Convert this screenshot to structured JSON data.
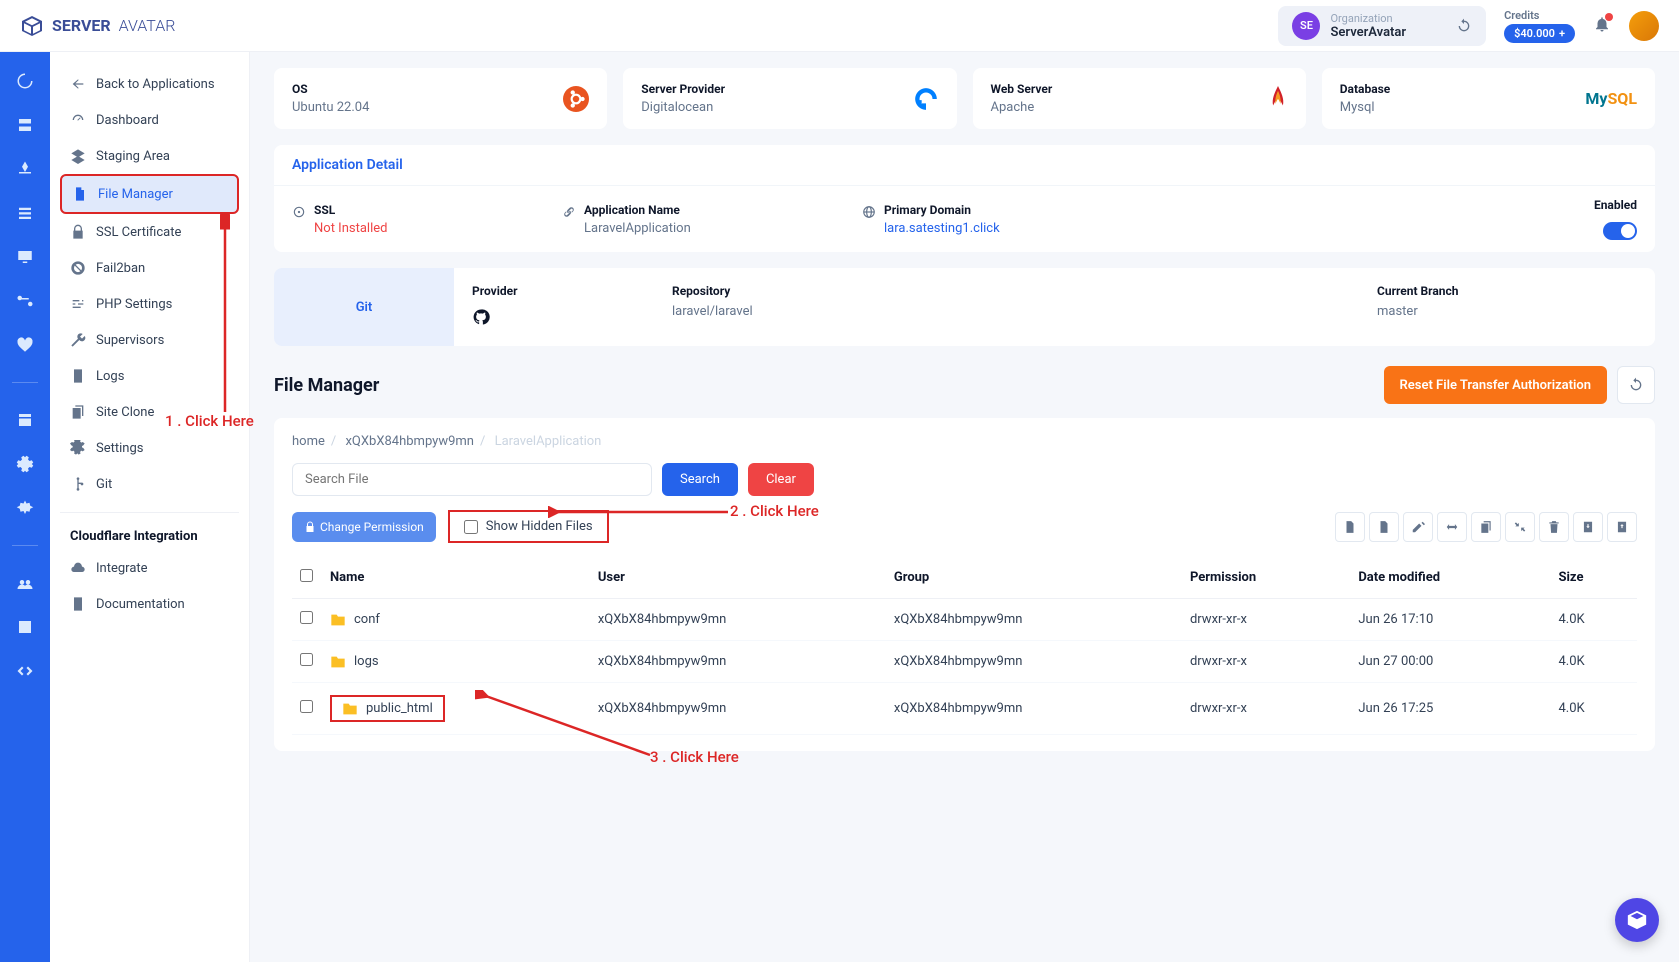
{
  "brand": {
    "name1": "SERVER",
    "name2": "AVATAR"
  },
  "org": {
    "badge": "SE",
    "label": "Organization",
    "name": "ServerAvatar"
  },
  "credits": {
    "label": "Credits",
    "value": "$40.000",
    "plus": "+"
  },
  "sidebar": {
    "back": "Back to Applications",
    "items": [
      {
        "label": "Dashboard"
      },
      {
        "label": "Staging Area"
      },
      {
        "label": "File Manager"
      },
      {
        "label": "SSL Certificate"
      },
      {
        "label": "Fail2ban"
      },
      {
        "label": "PHP Settings"
      },
      {
        "label": "Supervisors"
      },
      {
        "label": "Logs"
      },
      {
        "label": "Site Clone"
      },
      {
        "label": "Settings"
      },
      {
        "label": "Git"
      }
    ],
    "cloudflare": {
      "heading": "Cloudflare Integration",
      "integrate": "Integrate",
      "docs": "Documentation"
    }
  },
  "cards": {
    "os": {
      "label": "OS",
      "value": "Ubuntu 22.04"
    },
    "provider": {
      "label": "Server Provider",
      "value": "Digitalocean"
    },
    "web": {
      "label": "Web Server",
      "value": "Apache"
    },
    "db": {
      "label": "Database",
      "value": "Mysql"
    }
  },
  "appDetail": {
    "heading": "Application Detail",
    "ssl": {
      "label": "SSL",
      "value": "Not Installed"
    },
    "name": {
      "label": "Application Name",
      "value": "LaravelApplication"
    },
    "domain": {
      "label": "Primary Domain",
      "value": "lara.satesting1.click"
    },
    "enabled": "Enabled"
  },
  "git": {
    "tab": "Git",
    "provider": {
      "label": "Provider"
    },
    "repo": {
      "label": "Repository",
      "value": "laravel/laravel"
    },
    "branch": {
      "label": "Current Branch",
      "value": "master"
    }
  },
  "fm": {
    "title": "File Manager",
    "reset": "Reset File Transfer Authorization",
    "breadcrumb": {
      "p1": "home",
      "p2": "xQXbX84hbmpyw9mn",
      "p3": "LaravelApplication"
    },
    "search": {
      "placeholder": "Search File",
      "btn": "Search",
      "clear": "Clear"
    },
    "perm": "Change Permission",
    "hidden": "Show Hidden Files",
    "columns": {
      "name": "Name",
      "user": "User",
      "group": "Group",
      "permission": "Permission",
      "date": "Date modified",
      "size": "Size"
    },
    "rows": [
      {
        "name": "conf",
        "user": "xQXbX84hbmpyw9mn",
        "group": "xQXbX84hbmpyw9mn",
        "perm": "drwxr-xr-x",
        "date": "Jun 26 17:10",
        "size": "4.0K"
      },
      {
        "name": "logs",
        "user": "xQXbX84hbmpyw9mn",
        "group": "xQXbX84hbmpyw9mn",
        "perm": "drwxr-xr-x",
        "date": "Jun 27 00:00",
        "size": "4.0K"
      },
      {
        "name": "public_html",
        "user": "xQXbX84hbmpyw9mn",
        "group": "xQXbX84hbmpyw9mn",
        "perm": "drwxr-xr-x",
        "date": "Jun 26 17:25",
        "size": "4.0K"
      }
    ]
  },
  "annotations": {
    "a1": "1 . Click Here",
    "a2": "2 . Click Here",
    "a3": "3 . Click Here"
  }
}
